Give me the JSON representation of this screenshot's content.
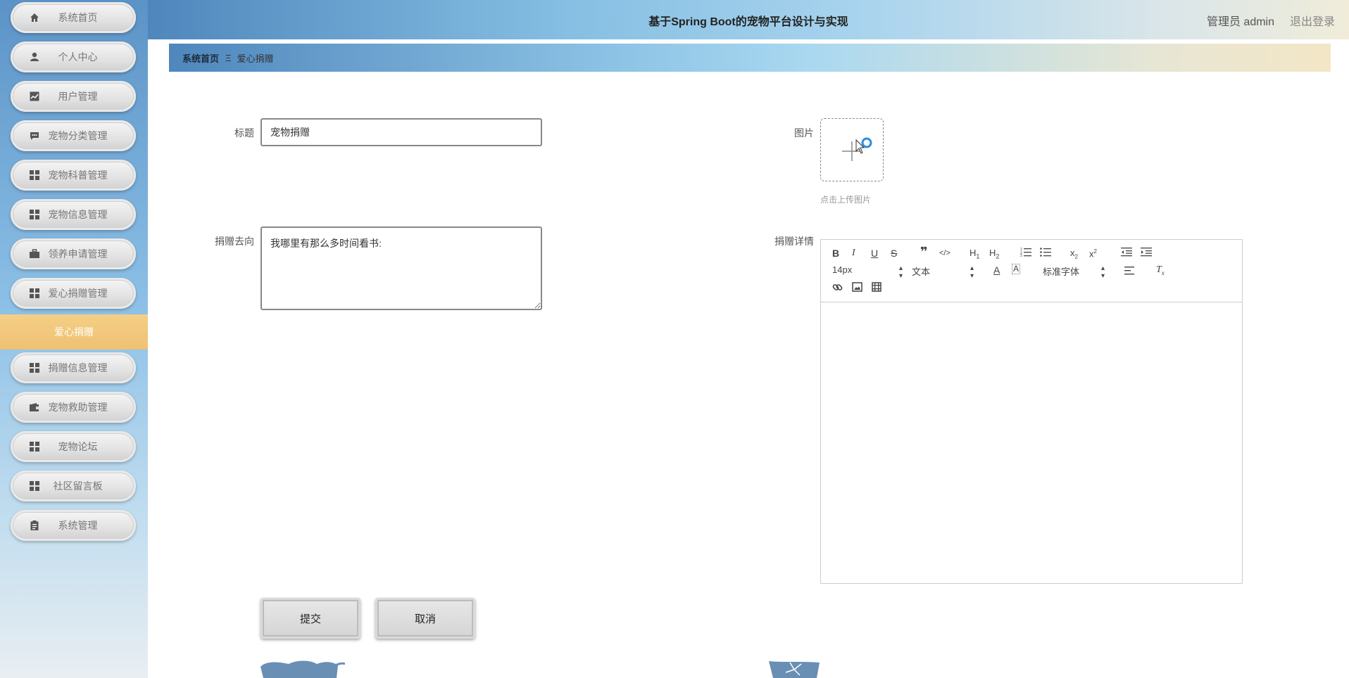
{
  "header": {
    "title": "基于Spring Boot的宠物平台设计与实现",
    "user": "管理员 admin",
    "logout": "退出登录"
  },
  "sidebar": {
    "items": [
      {
        "label": "系统首页",
        "icon": "home-icon"
      },
      {
        "label": "个人中心",
        "icon": "user-icon"
      },
      {
        "label": "用户管理",
        "icon": "chart-icon"
      },
      {
        "label": "宠物分类管理",
        "icon": "comment-icon"
      },
      {
        "label": "宠物科普管理",
        "icon": "grid-icon"
      },
      {
        "label": "宠物信息管理",
        "icon": "grid-icon"
      },
      {
        "label": "领养申请管理",
        "icon": "briefcase-icon"
      },
      {
        "label": "爱心捐赠管理",
        "icon": "grid-icon"
      }
    ],
    "active_label": "爱心捐赠",
    "items_after": [
      {
        "label": "捐赠信息管理",
        "icon": "grid-icon"
      },
      {
        "label": "宠物救助管理",
        "icon": "wallet-icon"
      },
      {
        "label": "宠物论坛",
        "icon": "grid-icon"
      },
      {
        "label": "社区留言板",
        "icon": "grid-icon"
      },
      {
        "label": "系统管理",
        "icon": "clipboard-icon"
      }
    ]
  },
  "breadcrumb": {
    "home": "系统首页",
    "separator": "Ξ",
    "current": "爱心捐赠"
  },
  "form": {
    "title_label": "标题",
    "title_value": "宠物捐赠",
    "image_label": "图片",
    "upload_hint": "点击上传图片",
    "destination_label": "捐赠去向",
    "destination_value": "我哪里有那么多时间看书:",
    "detail_label": "捐赠详情",
    "submit": "提交",
    "cancel": "取消"
  },
  "editor": {
    "font_size": "14px",
    "text_type": "文本",
    "font_family": "标准字体",
    "buttons": [
      "bold-icon",
      "italic-icon",
      "underline-icon",
      "strike-icon",
      "quote-icon",
      "code-icon",
      "h1-icon",
      "h2-icon",
      "ordered-list-icon",
      "bullet-list-icon",
      "subscript-icon",
      "superscript-icon",
      "outdent-icon",
      "indent-icon",
      "font-color-icon",
      "background-color-icon",
      "align-icon",
      "clear-format-icon",
      "link-icon",
      "image-icon",
      "video-icon"
    ]
  },
  "colors": {
    "active_nav": "#f0c476",
    "header_start": "#4f87bd",
    "header_end": "#f0ecd9"
  }
}
